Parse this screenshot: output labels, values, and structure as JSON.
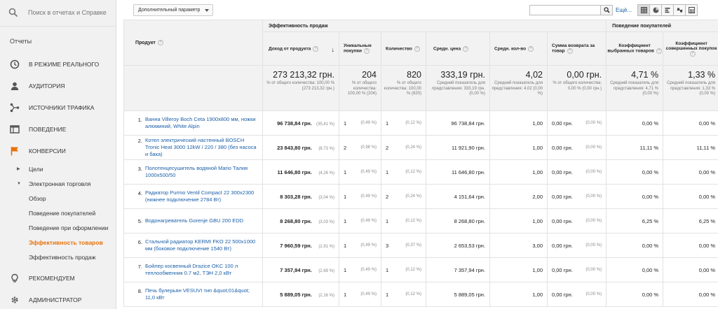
{
  "search": {
    "placeholder": "Поиск в отчетах и Справке"
  },
  "sidebar": {
    "section_label": "Отчеты",
    "items": [
      {
        "label": "В РЕЖИМЕ РЕАЛЬНОГО",
        "icon": "clock-icon"
      },
      {
        "label": "АУДИТОРИЯ",
        "icon": "person-icon"
      },
      {
        "label": "ИСТОЧНИКИ ТРАФИКА",
        "icon": "fork-icon"
      },
      {
        "label": "ПОВЕДЕНИЕ",
        "icon": "window-icon"
      },
      {
        "label": "КОНВЕРСИИ",
        "icon": "flag-icon",
        "color": "#e8710a"
      }
    ],
    "sub": [
      {
        "label": "Цели",
        "arrow": "▶"
      },
      {
        "label": "Электронная торговля",
        "arrow": "▼"
      }
    ],
    "leaves": [
      {
        "label": "Обзор"
      },
      {
        "label": "Поведение покупателей"
      },
      {
        "label": "Поведение при оформлении"
      },
      {
        "label": "Эффективность товаров",
        "active": true
      },
      {
        "label": "Эффективность продаж"
      }
    ],
    "bottom": [
      {
        "label": "РЕКОМЕНДУЕМ",
        "icon": "lightbulb-icon"
      },
      {
        "label": "АДМИНИСТРАТОР",
        "icon": "gear-icon"
      }
    ]
  },
  "toolbar": {
    "dropdown_label": "Дополнительный параметр",
    "more_link": "Ещё...",
    "accent": "#1a5fa8"
  },
  "table": {
    "groups": {
      "sales": "Эффективность продаж",
      "behavior": "Поведение покупателей"
    },
    "headers": {
      "product": "Продукт",
      "revenue": "Доход от продукта",
      "unique": "Уникальные покупки",
      "qty": "Количество",
      "avg_price": "Средн. цена",
      "avg_qty": "Средн. кол-во",
      "refund": "Сумма возврата за товар",
      "cart_ratio": "Коэффициент выбранных товаров",
      "buy_ratio": "Коэффициент совершенных покупок"
    },
    "totals": {
      "revenue": "273 213,32 грн.",
      "revenue_note": "% от общего количества: 100,00 % (273 213,32 грн.)",
      "unique": "204",
      "unique_note": "% от общего количества: 100,00 % (204)",
      "qty": "820",
      "qty_note": "% от общего количества: 100,00 % (820)",
      "avg_price": "333,19 грн.",
      "avg_price_note": "Средний показатель для представления: 333,19 грн. (0,00 %)",
      "avg_qty": "4,02",
      "avg_qty_note": "Средний показатель для представления: 4,02 (0,00 %)",
      "refund": "0,00 грн.",
      "refund_note": "% от общего количества: 0,00 % (0,00 грн.)",
      "cart_ratio": "4,71 %",
      "cart_ratio_note": "Средний показатель для представления: 4,71 % (0,00 %)",
      "buy_ratio": "1,33 %",
      "buy_ratio_note": "Средний показатель для представления: 1,33 % (0,00 %)"
    },
    "rows": [
      {
        "n": "1.",
        "name": "Ванна Villeroy Boch Ceta 1900x800 мм, ножки алюминий, White Alpin",
        "revenue": "96 738,84 грн.",
        "revenue_pct": "(35,41 %)",
        "unique": "1",
        "unique_pct": "(0,49 %)",
        "qty": "1",
        "qty_pct": "(0,12 %)",
        "avg_price": "96 738,84 грн.",
        "avg_qty": "1,00",
        "refund": "0,00 грн.",
        "refund_pct": "(0,00 %)",
        "cart": "0,00 %",
        "buy": "0,00 %"
      },
      {
        "n": "2.",
        "name": "Котел электрический настенный BOSCH Tronic Heat 3000 12kW / 220 / 380 (без насоса и бака)",
        "revenue": "23 843,80 грн.",
        "revenue_pct": "(8,73 %)",
        "unique": "2",
        "unique_pct": "(0,98 %)",
        "qty": "2",
        "qty_pct": "(0,24 %)",
        "avg_price": "11 921,90 грн.",
        "avg_qty": "1,00",
        "refund": "0,00 грн.",
        "refund_pct": "(0,00 %)",
        "cart": "11,11 %",
        "buy": "11,11 %"
      },
      {
        "n": "3.",
        "name": "Полотенцесушитель водяной Mario Талия 1000x500/50",
        "revenue": "11 646,80 грн.",
        "revenue_pct": "(4,26 %)",
        "unique": "1",
        "unique_pct": "(0,49 %)",
        "qty": "1",
        "qty_pct": "(0,12 %)",
        "avg_price": "11 646,80 грн.",
        "avg_qty": "1,00",
        "refund": "0,00 грн.",
        "refund_pct": "(0,00 %)",
        "cart": "0,00 %",
        "buy": "0,00 %"
      },
      {
        "n": "4.",
        "name": "Радиатор Purmo Ventil Compact 22 300x2300 (нижнее подключение 2784 Вт)",
        "revenue": "8 303,28 грн.",
        "revenue_pct": "(3,04 %)",
        "unique": "1",
        "unique_pct": "(0,49 %)",
        "qty": "2",
        "qty_pct": "(0,24 %)",
        "avg_price": "4 151,64 грн.",
        "avg_qty": "2,00",
        "refund": "0,00 грн.",
        "refund_pct": "(0,00 %)",
        "cart": "0,00 %",
        "buy": "0,00 %"
      },
      {
        "n": "5.",
        "name": "Водонагреватель Gorenje GBU 200 EDD",
        "revenue": "8 268,80 грн.",
        "revenue_pct": "(3,03 %)",
        "unique": "1",
        "unique_pct": "(0,49 %)",
        "qty": "1",
        "qty_pct": "(0,12 %)",
        "avg_price": "8 268,80 грн.",
        "avg_qty": "1,00",
        "refund": "0,00 грн.",
        "refund_pct": "(0,00 %)",
        "cart": "6,25 %",
        "buy": "6,25 %"
      },
      {
        "n": "6.",
        "name": "Стальной радиатор KERMI FKO 22 500x1000 мм (боковое подключение 1540 Вт)",
        "revenue": "7 960,59 грн.",
        "revenue_pct": "(2,91 %)",
        "unique": "1",
        "unique_pct": "(0,49 %)",
        "qty": "3",
        "qty_pct": "(0,37 %)",
        "avg_price": "2 653,53 грн.",
        "avg_qty": "3,00",
        "refund": "0,00 грн.",
        "refund_pct": "(0,00 %)",
        "cart": "0,00 %",
        "buy": "0,00 %"
      },
      {
        "n": "7.",
        "name": "Бойлер косвенный Drazice OKC 100 л теплообменник 0.7 м2, ТЭН 2,0 кВт",
        "revenue": "7 357,94 грн.",
        "revenue_pct": "(2,69 %)",
        "unique": "1",
        "unique_pct": "(0,49 %)",
        "qty": "1",
        "qty_pct": "(0,12 %)",
        "avg_price": "7 357,94 грн.",
        "avg_qty": "1,00",
        "refund": "0,00 грн.",
        "refund_pct": "(0,00 %)",
        "cart": "0,00 %",
        "buy": "0,00 %"
      },
      {
        "n": "8.",
        "name": "Печь булерьян VESUVI тип &quot;01&quot; 11,0 кВт",
        "revenue": "5 889,05 грн.",
        "revenue_pct": "(2,16 %)",
        "unique": "1",
        "unique_pct": "(0,49 %)",
        "qty": "1",
        "qty_pct": "(0,12 %)",
        "avg_price": "5 889,05 грн.",
        "avg_qty": "1,00",
        "refund": "0,00 грн.",
        "refund_pct": "(0,00 %)",
        "cart": "0,00 %",
        "buy": "0,00 %"
      }
    ]
  }
}
